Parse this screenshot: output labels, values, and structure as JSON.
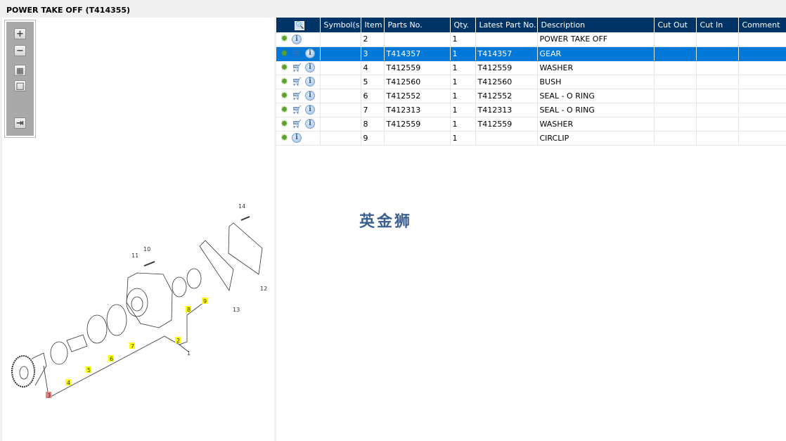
{
  "title": "POWER TAKE OFF (T414355)",
  "toolbar": [
    {
      "name": "zoom-in",
      "glyph": "+"
    },
    {
      "name": "zoom-out",
      "glyph": "−"
    },
    {
      "name": "fit-all",
      "glyph": "▦"
    },
    {
      "name": "fit-window",
      "glyph": "□"
    },
    {
      "name": "export",
      "glyph": "⇥"
    }
  ],
  "diagram": {
    "callouts": [
      "1",
      "2",
      "3",
      "4",
      "5",
      "6",
      "7",
      "8",
      "9",
      "10",
      "11",
      "12",
      "13",
      "14"
    ],
    "highlighted_color": "#ffff00",
    "selected_color": "#f08080",
    "selected": "3"
  },
  "table": {
    "columns": [
      "",
      "Symbol(s)",
      "Item",
      "Parts No.",
      "Qty.",
      "Latest Part No.",
      "Description",
      "Cut Out",
      "Cut In",
      "Comment"
    ],
    "rows": [
      {
        "item": "2",
        "parts_no": "",
        "qty": "1",
        "latest": "",
        "desc": "POWER TAKE OFF",
        "cart": false,
        "selected": false
      },
      {
        "item": "3",
        "parts_no": "T414357",
        "qty": "1",
        "latest": "T414357",
        "desc": "GEAR",
        "cart": true,
        "selected": true
      },
      {
        "item": "4",
        "parts_no": "T412559",
        "qty": "1",
        "latest": "T412559",
        "desc": "WASHER",
        "cart": true,
        "selected": false
      },
      {
        "item": "5",
        "parts_no": "T412560",
        "qty": "1",
        "latest": "T412560",
        "desc": "BUSH",
        "cart": true,
        "selected": false
      },
      {
        "item": "6",
        "parts_no": "T412552",
        "qty": "1",
        "latest": "T412552",
        "desc": "SEAL - O RING",
        "cart": true,
        "selected": false
      },
      {
        "item": "7",
        "parts_no": "T412313",
        "qty": "1",
        "latest": "T412313",
        "desc": "SEAL - O RING",
        "cart": true,
        "selected": false
      },
      {
        "item": "8",
        "parts_no": "T412559",
        "qty": "1",
        "latest": "T412559",
        "desc": "WASHER",
        "cart": true,
        "selected": false
      },
      {
        "item": "9",
        "parts_no": "",
        "qty": "1",
        "latest": "",
        "desc": "CIRCLIP",
        "cart": false,
        "selected": false
      }
    ]
  },
  "watermark": "英金狮",
  "colors": {
    "header": "#003366",
    "selected_row": "#0078d7"
  }
}
